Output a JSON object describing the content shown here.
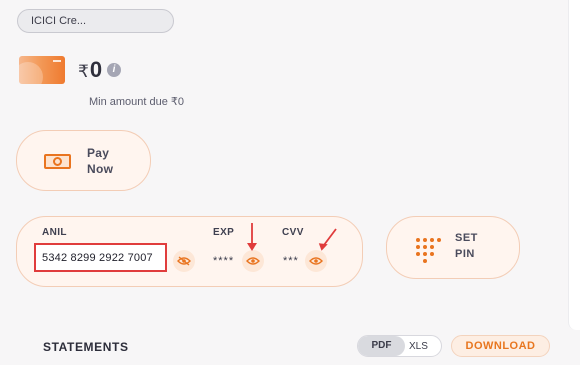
{
  "card_selector": {
    "value": "ICICI Cre..."
  },
  "balance": {
    "currency": "₹",
    "amount": "0"
  },
  "info": {
    "glyph": "i"
  },
  "min_due": "Min amount due ₹0",
  "pay_now": {
    "line1": "Pay",
    "line2": "Now"
  },
  "card_details": {
    "name_label": "ANIL",
    "exp_label": "EXP",
    "cvv_label": "CVV",
    "card_number": "5342 8299 2922 7007",
    "exp_masked": "****",
    "cvv_masked": "***"
  },
  "set_pin": {
    "line1": "SET",
    "line2": "PIN"
  },
  "statements": {
    "title": "STATEMENTS",
    "formats": [
      "PDF",
      "XLS"
    ],
    "selected_format": "PDF",
    "download_label": "DOWNLOAD"
  },
  "colors": {
    "accent": "#e9741f",
    "panel_bg": "#fff5ef",
    "highlight_border": "#e03c3c",
    "annotation_arrow": "#e03c3c"
  },
  "icons": {
    "pay": "banknote-icon",
    "reveal": "eye-off-icon",
    "eye": "eye-icon",
    "pin": "keypad-icon",
    "info": "info-icon"
  }
}
